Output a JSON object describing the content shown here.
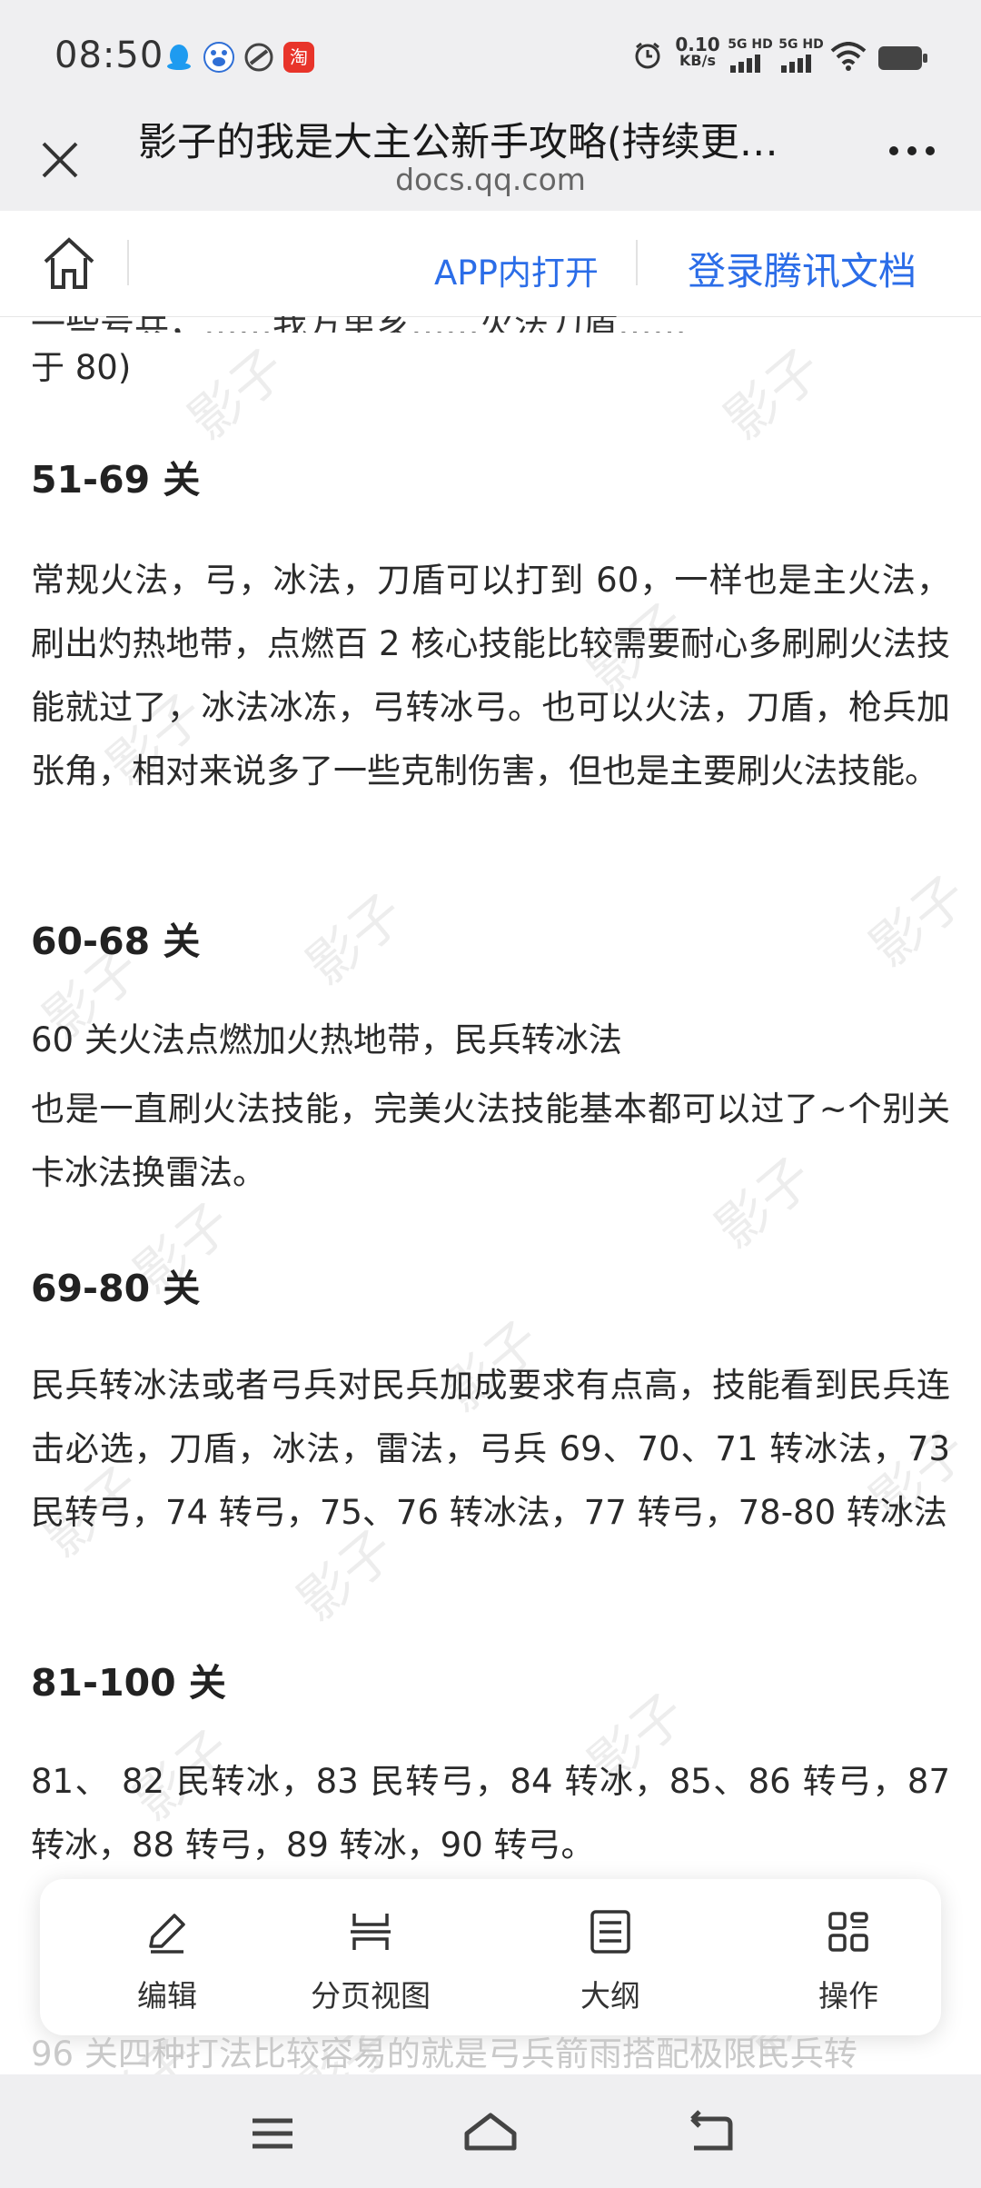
{
  "status_bar": {
    "time": "08:50",
    "app_icons": [
      "qq-icon",
      "baidu-icon",
      "browser-icon",
      "taobao-icon"
    ],
    "net_speed_value": "0.10",
    "net_speed_unit": "KB/s",
    "signal_1_label": "5G HD",
    "signal_2_label": "5G HD"
  },
  "header": {
    "title": "影子的我是大主公新手攻略(持续更…",
    "domain": "docs.qq.com"
  },
  "doc_toolbar": {
    "open_in_app": "APP内打开",
    "login": "登录腾讯文档"
  },
  "doc": {
    "cut_line": "一些号兵，……我方里亥……火法刀盾……",
    "intro_tail": "于 80)",
    "sections": [
      {
        "heading": "51-69 关",
        "paras": [
          "常规火法，弓，冰法，刀盾可以打到 60，一样也是主火法，刷出灼热地带，点燃百 2 核心技能比较需要耐心多刷刷火法技能就过了，冰法冰冻，弓转冰弓。也可以火法，刀盾，枪兵加张角，相对来说多了一些克制伤害，但也是主要刷火法技能。"
        ]
      },
      {
        "heading": "60-68 关",
        "paras": [
          "60 关火法点燃加火热地带，民兵转冰法",
          "也是一直刷火法技能，完美火法技能基本都可以过了~个别关卡冰法换雷法。"
        ]
      },
      {
        "heading": "69-80 关",
        "paras": [
          "民兵转冰法或者弓兵对民兵加成要求有点高，技能看到民兵连击必选，刀盾，冰法，雷法，弓兵 69、70、71 转冰法，73 民转弓，74 转弓，75、76 转冰法，77 转弓，78-80 转冰法"
        ]
      },
      {
        "heading": "81-100 关",
        "paras": [
          "81、 82 民转冰，83 民转弓，84 转冰，85、86 转弓，87 转冰，88 转弓，89 转冰，90 转弓。"
        ]
      }
    ],
    "peek_line": "96 关四种打法比较容易的就是弓兵箭雨搭配极限民兵转",
    "watermark": "影子"
  },
  "float_toolbar": {
    "items": [
      {
        "label": "编辑",
        "icon": "pencil-icon"
      },
      {
        "label": "分页视图",
        "icon": "page-view-icon"
      },
      {
        "label": "大纲",
        "icon": "outline-icon"
      },
      {
        "label": "操作",
        "icon": "grid-icon"
      }
    ]
  },
  "nav_bar": {
    "icons": [
      "menu-icon",
      "home-icon",
      "back-icon"
    ]
  }
}
